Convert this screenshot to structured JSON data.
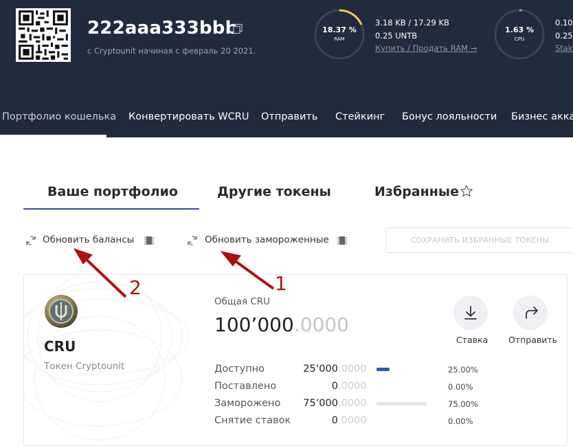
{
  "account": {
    "name": "222aaa333bbb",
    "since": "с Cryptounit начиная с февраль 20 2021."
  },
  "ram": {
    "percent_label": "18.37 %",
    "percent": 18.37,
    "label": "RAM",
    "usage": "3.18 KB / 17.29 KB",
    "balance": "0.25 UNTB",
    "link": "Купить / Продать RAM →"
  },
  "cpu": {
    "percent_label": "1.63 %",
    "percent": 1.63,
    "label": "CPU",
    "line1": "0.10",
    "line2": "0.25",
    "link": "Stake"
  },
  "nav": {
    "items": [
      {
        "label": "Портфолио кошелька",
        "active": true
      },
      {
        "label": "Конвертировать WCRU"
      },
      {
        "label": "Отправить"
      },
      {
        "label": "Стейкинг"
      },
      {
        "label": "Бонус лояльности"
      },
      {
        "label": "Бизнес аккау"
      }
    ]
  },
  "tabs": [
    {
      "label": "Ваше портфолио",
      "active": true
    },
    {
      "label": "Другие токены"
    },
    {
      "label": "Избранные"
    }
  ],
  "actions": {
    "refresh_balances": "Обновить балансы",
    "refresh_frozen": "Обновить замороженные",
    "save_favorites": "СОХРАНИТЬ ИЗБРАННЫЕ ТОКЕНЫ"
  },
  "token": {
    "symbol": "CRU",
    "name": "Токен Cryptounit",
    "total_label": "Общая CRU",
    "total_int": "100’000",
    "total_dec": ".0000",
    "stake_label": "Ставка",
    "send_label": "Отправить",
    "rows": [
      {
        "label": "Доступно",
        "int": "25’000",
        "dec": ".0000",
        "pct": "25.00%",
        "fraction": 0.25
      },
      {
        "label": "Поставлено",
        "int": "0",
        "dec": ".0000",
        "pct": "0.00%",
        "fraction": 0
      },
      {
        "label": "Заморожено",
        "int": "75’000",
        "dec": ".0000",
        "pct": "75.00%",
        "fraction": 0.75
      },
      {
        "label": "Снятие ставок",
        "int": "0",
        "dec": ".0000",
        "pct": "0.00%",
        "fraction": 0
      }
    ]
  },
  "annotations": {
    "arrow1": "1",
    "arrow2": "2"
  },
  "colors": {
    "header_bg": "#222b3e",
    "ram_arc": "#f2c94c",
    "cpu_arc": "#3ecf8e",
    "bar_fill": "#2f56b8",
    "annotation": "#b01010"
  }
}
